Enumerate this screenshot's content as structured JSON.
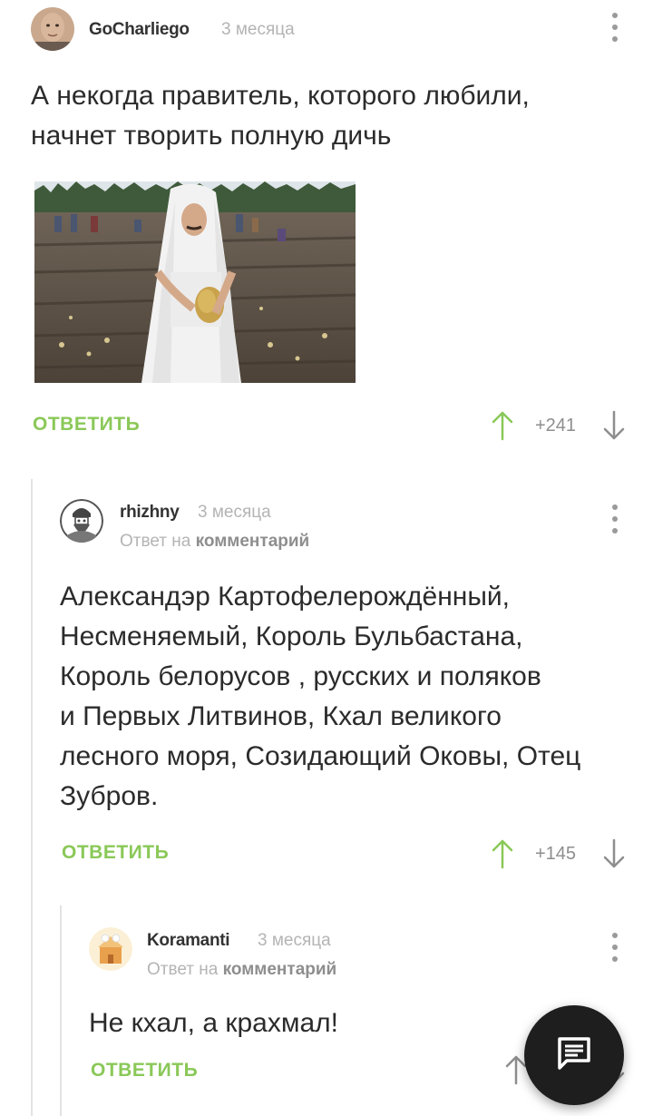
{
  "comments": [
    {
      "username": "GoCharliego",
      "time": "3 месяца",
      "text_lines": [
        "А некогда правитель, которого любили,",
        "начнет творить полную дичь"
      ],
      "reply_label": "ОТВЕТИТЬ",
      "score": "+241"
    },
    {
      "username": "rhizhny",
      "time": "3 месяца",
      "reply_to_prefix": "Ответ на",
      "reply_to_link": "комментарий",
      "text_lines": [
        "Александэр Картофелерождённый,",
        "Несменяемый, Король Бульбастана,",
        "Король белорусов , русских и поляков",
        "и Первых Литвинов, Кхал великого",
        "лесного моря, Созидающий Оковы, Отец",
        "Зубров."
      ],
      "reply_label": "ОТВЕТИТЬ",
      "score": "+145"
    },
    {
      "username": "Koramanti",
      "time": "3 месяца",
      "reply_to_prefix": "Ответ на",
      "reply_to_link": "комментарий",
      "text_lines": [
        "Не кхал, а крахмал!"
      ],
      "reply_label": "ОТВЕТИТЬ"
    }
  ],
  "colors": {
    "accent_green": "#8ac858",
    "muted": "#b4b4b4",
    "fab": "#1e1e1e"
  },
  "icons": {
    "upvote": "arrow-up-icon",
    "downvote": "arrow-down-icon",
    "menu": "kebab-menu-icon",
    "fab": "chat-icon"
  }
}
